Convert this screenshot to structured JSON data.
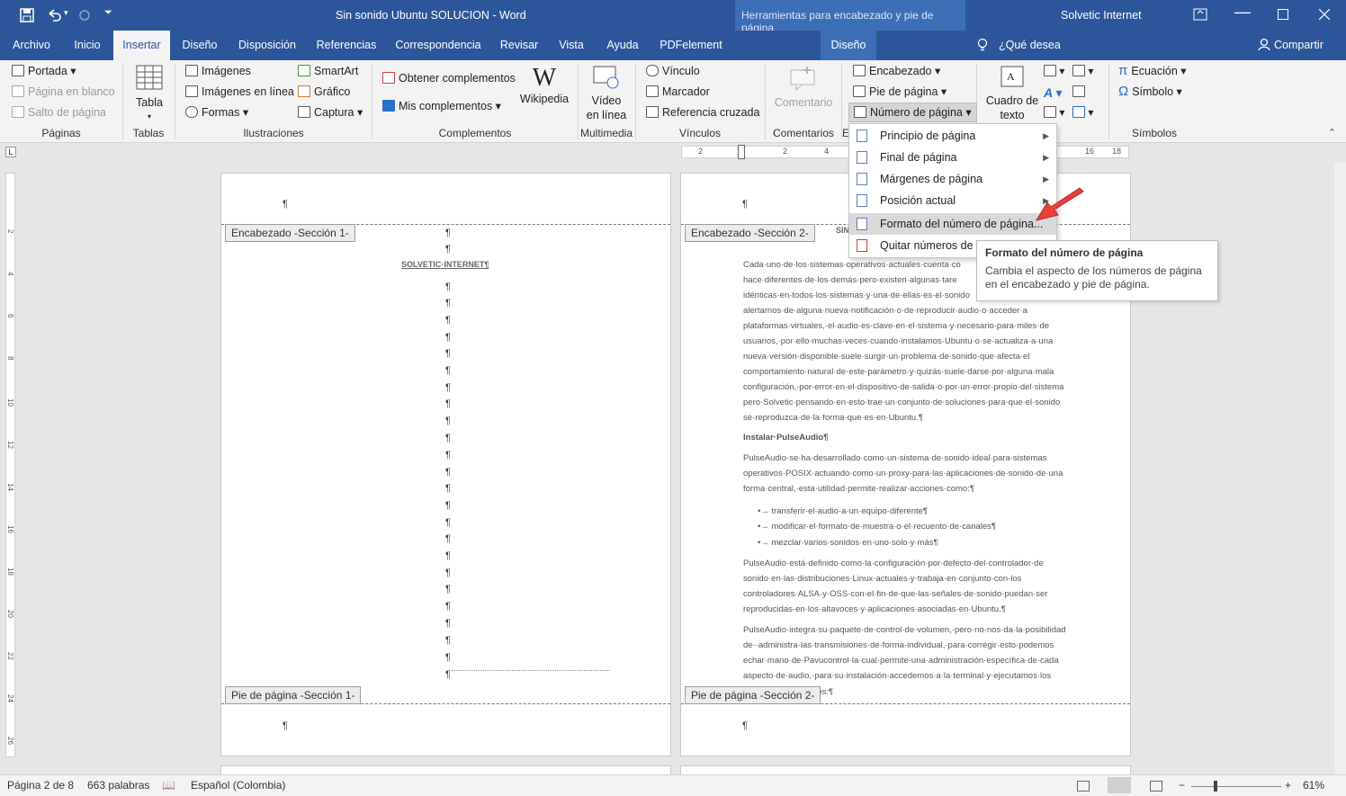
{
  "title_bar": {
    "doc_title": "Sin sonido Ubuntu SOLUCION  -  Word",
    "context_title": "Herramientas para encabezado y pie de página",
    "user": "Solvetic Internet"
  },
  "tabs": [
    "Archivo",
    "Inicio",
    "Insertar",
    "Diseño",
    "Disposición",
    "Referencias",
    "Correspondencia",
    "Revisar",
    "Vista",
    "Ayuda",
    "PDFelement"
  ],
  "context_tab": "Diseño",
  "tell_me": "¿Qué desea hacer?",
  "share": "Compartir",
  "ribbon": {
    "paginas": {
      "portada": "Portada",
      "pagina_blanco": "Página en blanco",
      "salto": "Salto de página",
      "label": "Páginas"
    },
    "tablas": {
      "tabla": "Tabla",
      "label": "Tablas"
    },
    "ilustraciones": {
      "imagenes": "Imágenes",
      "imagenes_linea": "Imágenes en línea",
      "formas": "Formas",
      "smartart": "SmartArt",
      "grafico": "Gráfico",
      "captura": "Captura",
      "label": "Ilustraciones"
    },
    "complementos": {
      "obtener": "Obtener complementos",
      "mis": "Mis complementos",
      "wikipedia": "Wikipedia",
      "label": "Complementos"
    },
    "multimedia": {
      "video1": "Vídeo",
      "video2": "en línea",
      "label": "Multimedia"
    },
    "vinculos": {
      "vinculo": "Vínculo",
      "marcador": "Marcador",
      "ref": "Referencia cruzada",
      "label": "Vínculos"
    },
    "comentarios": {
      "comentario": "Comentario",
      "label": "Comentarios"
    },
    "encabezado": {
      "encabezado": "Encabezado",
      "pie": "Pie de página",
      "numero": "Número de página",
      "label": "E"
    },
    "texto": {
      "cuadro1": "Cuadro de",
      "cuadro2": "texto"
    },
    "simbolos": {
      "ecuacion": "Ecuación",
      "simbolo": "Símbolo",
      "label": "Símbolos"
    }
  },
  "ruler_ticks": [
    "2",
    "2",
    "4",
    "16",
    "18"
  ],
  "vruler_ticks": [
    "2",
    "4",
    "6",
    "8",
    "10",
    "12",
    "14",
    "16",
    "18",
    "20",
    "22",
    "24",
    "26"
  ],
  "page1": {
    "pilcrow": "¶",
    "header_tag": "Encabezado -Sección 1-",
    "footer_tag": "Pie de página -Sección 1-",
    "title": "SOLVETIC·INTERNET¶"
  },
  "page2": {
    "header_tag": "Encabezado -Sección 2-",
    "footer_tag": "Pie de página -Sección 2-",
    "heading_frag": "SIN",
    "para1": "Cada·uno·de·los·sistemas·operativos·actuales·cuenta·co hace·diferentes·de·los·demás·pero·existen·algunas·tare idénticas·en·todos·los·sistemas·y·una·de·ellas·es·el·sonido alertarnos·de·alguna·nueva·notificación·o·de·reproducir·audio·o·acceder·a plataformas·virtuales,·el·audio·es·clave·en·el·sistema·y·necesario·para·miles·de usuarios,·por·ello·muchas·veces·cuando·instalamos·Ubuntu·o·se·actualiza·a·una nueva·versión·disponible·suele·surgir·un·problema·de·sonido·que·afecta·el comportamiento·natural·de·este·parámetro·y·quizás·suele·darse·por·alguna·mala configuración,·por·error·en·el·dispositivo·de·salida·o·por·un·error·propio·del·sistema pero·Solvetic·pensando·en·esto·trae·un·conjunto·de·soluciones·para·que·el·sonido se·reproduzca·de·la·forma·que·es·en·Ubuntu.¶",
    "heading2": "Instalar·PulseAudio¶",
    "para2": "PulseAudio·se·ha·desarrollado·como·un·sistema·de·sonido·ideal·para·sistemas operativos·POSIX·actuando·como·un·proxy·para·las·aplicaciones·de·sonido·de·una forma·central,·esta·utilidad·permite·realizar·acciones·como:¶",
    "bullets": [
      "•→ transferir·el·audio·a·un·equipo·diferente¶",
      "•→ modificar·el·formato·de·muestra·o·el·recuento·de·canales¶",
      "•→ mezclar·varios·sonidos·en·uno·solo·y·más¶"
    ],
    "para3": "PulseAudio·está·definido·como·la·configuración·por·defecto·del·controlador·de sonido·en·las·distribuciones·Linux·actuales·y·trabaja·en·conjunto·con·los controladores·ALSA·y·OSS·con·el·fin·de·que·las·señales·de·sonido·puedan·ser reproducidas·en·los·altavoces·y·aplicaciones·asociadas·en·Ubuntu.¶",
    "para4": "PulseAudio·integra·su·paquete·de·control·de·volumen,·pero·no·nos·da·la·posibilidad de··administra·las·transmisiones·de·forma·individual,·para·corregir·esto·podemos echar·mano·de·Pavucontrol·la·cual·permite·una·administración·específica·de·cada aspecto·de·audio,·para·su·instalación·accedemos·a·la·terminal·y·ejecutamos·los",
    "para4_end": "dos:¶"
  },
  "menu": {
    "items": [
      "Principio de página",
      "Final de página",
      "Márgenes de página",
      "Posición actual",
      "Formato del número de página...",
      "Quitar números de p"
    ]
  },
  "tooltip": {
    "title": "Formato del número de página",
    "body": "Cambia el aspecto de los números de página en el encabezado y pie de página."
  },
  "status": {
    "page": "Página 2 de 8",
    "words": "663 palabras",
    "lang": "Español (Colombia)",
    "zoom": "61%"
  },
  "colors": {
    "brand": "#2b579a",
    "arrow": "#e8403b"
  }
}
